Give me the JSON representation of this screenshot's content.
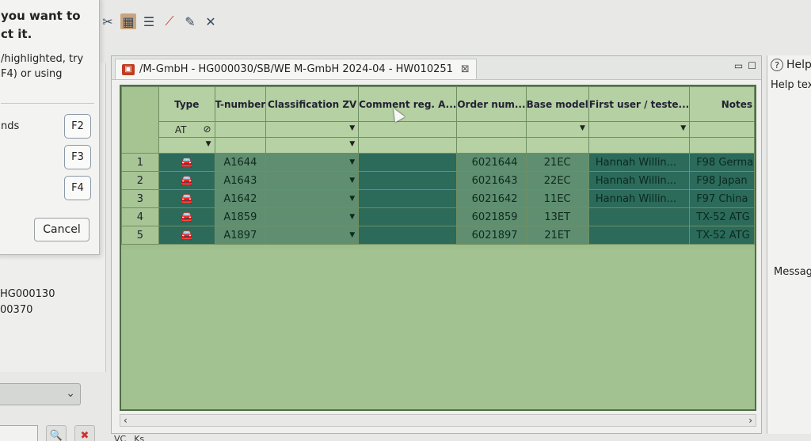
{
  "toolbar": {
    "icons": [
      "scissors-icon",
      "package-icon",
      "list-icon",
      "cross-red-icon",
      "pencil-icon",
      "tools-icon"
    ]
  },
  "dialog": {
    "message_bold": "you want to\nct it.",
    "message_body": "/highlighted, try\nF4) or using",
    "label": "nds",
    "keys": [
      "F2",
      "F3",
      "F4"
    ],
    "cancel_label": "Cancel"
  },
  "left_panel": {
    "ids": [
      "HG000130",
      "00370"
    ]
  },
  "editor": {
    "tab_title": "/M-GmbH - HG000030/SB/WE M-GmbH 2024-04 - HW010251",
    "columns": [
      "Type",
      "T-number",
      "Classification ZV",
      "Comment reg. A...",
      "Order num...",
      "Base model",
      "First user / teste...",
      "Notes"
    ],
    "filter_type_value": "AT",
    "rows": [
      {
        "num": "1",
        "t_number": "A1644",
        "order": "6021644",
        "base": "21EC",
        "first_user": "Hannah Willin...",
        "notes": "F98 Germa"
      },
      {
        "num": "2",
        "t_number": "A1643",
        "order": "6021643",
        "base": "22EC",
        "first_user": "Hannah Willin...",
        "notes": "F98 Japan"
      },
      {
        "num": "3",
        "t_number": "A1642",
        "order": "6021642",
        "base": "11EC",
        "first_user": "Hannah Willin...",
        "notes": "F97 China"
      },
      {
        "num": "4",
        "t_number": "A1859",
        "order": "6021859",
        "base": "13ET",
        "first_user": "",
        "notes": "TX-52 ATG"
      },
      {
        "num": "5",
        "t_number": "A1897",
        "order": "6021897",
        "base": "21ET",
        "first_user": "",
        "notes": "TX-52 ATG"
      }
    ]
  },
  "help": {
    "title": "Help",
    "text": "Help tex",
    "messages_title": "Messag"
  },
  "bottom_tabs": [
    "VC",
    "Ks"
  ]
}
